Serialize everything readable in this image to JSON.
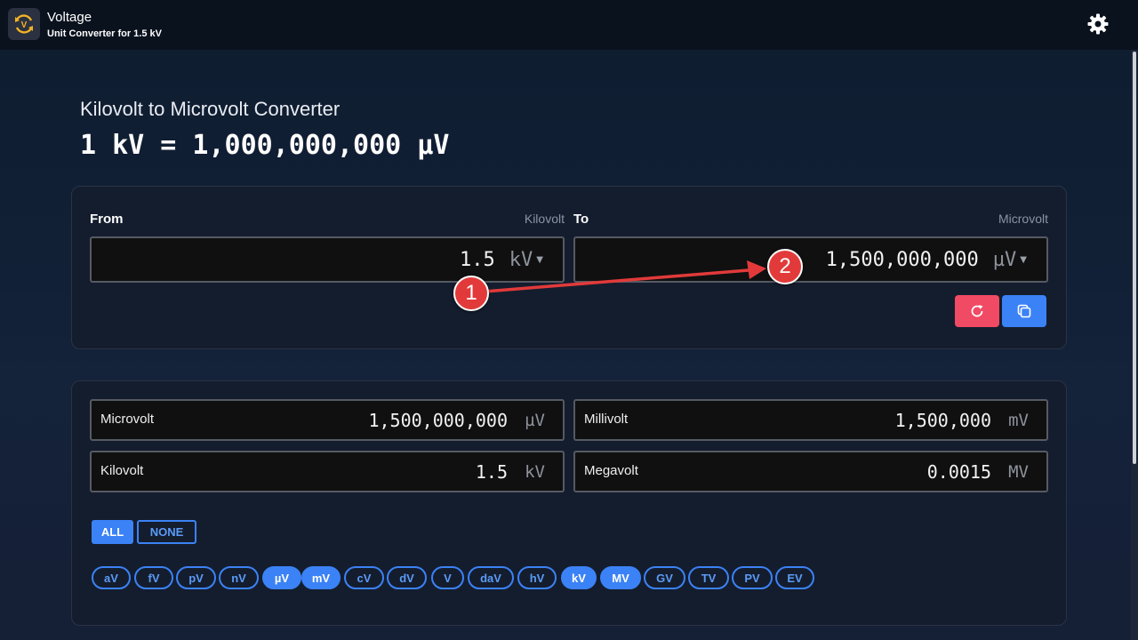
{
  "header": {
    "app_title": "Voltage",
    "app_subtitle": "Unit Converter for 1.5 kV"
  },
  "page": {
    "heading": "Kilovolt to Microvolt Converter",
    "formula": "1 kV = 1,000,000,000 µV"
  },
  "converter": {
    "from": {
      "label": "From",
      "unit_name": "Kilovolt",
      "value": "1.5",
      "unit": "kV"
    },
    "to": {
      "label": "To",
      "unit_name": "Microvolt",
      "value": "1,500,000,000",
      "unit": "µV"
    },
    "caret": "▼"
  },
  "results": [
    {
      "name": "Microvolt",
      "value": "1,500,000,000",
      "unit": "µV"
    },
    {
      "name": "Millivolt",
      "value": "1,500,000",
      "unit": "mV"
    },
    {
      "name": "Kilovolt",
      "value": "1.5",
      "unit": "kV"
    },
    {
      "name": "Megavolt",
      "value": "0.0015",
      "unit": "MV"
    }
  ],
  "filters": {
    "all_label": "ALL",
    "none_label": "NONE"
  },
  "units": [
    {
      "label": "aV",
      "selected": false
    },
    {
      "label": "fV",
      "selected": false
    },
    {
      "label": "pV",
      "selected": false
    },
    {
      "label": "nV",
      "selected": false
    },
    {
      "label": "µV",
      "selected": true
    },
    {
      "label": "mV",
      "selected": true
    },
    {
      "label": "cV",
      "selected": false
    },
    {
      "label": "dV",
      "selected": false
    },
    {
      "label": "V",
      "selected": false
    },
    {
      "label": "daV",
      "selected": false
    },
    {
      "label": "hV",
      "selected": false
    },
    {
      "label": "kV",
      "selected": true
    },
    {
      "label": "MV",
      "selected": true
    },
    {
      "label": "GV",
      "selected": false
    },
    {
      "label": "TV",
      "selected": false
    },
    {
      "label": "PV",
      "selected": false
    },
    {
      "label": "EV",
      "selected": false
    }
  ],
  "annotations": {
    "marker_1": "1",
    "marker_2": "2"
  },
  "colors": {
    "accent": "#3b82f6",
    "reset": "#f04a64",
    "annotation": "#e23a3a",
    "logo": "#f5b324"
  },
  "icons": {
    "logo": "refresh-voltage-icon",
    "settings": "gear-icon",
    "reset": "refresh-icon",
    "copy": "copy-icon"
  }
}
